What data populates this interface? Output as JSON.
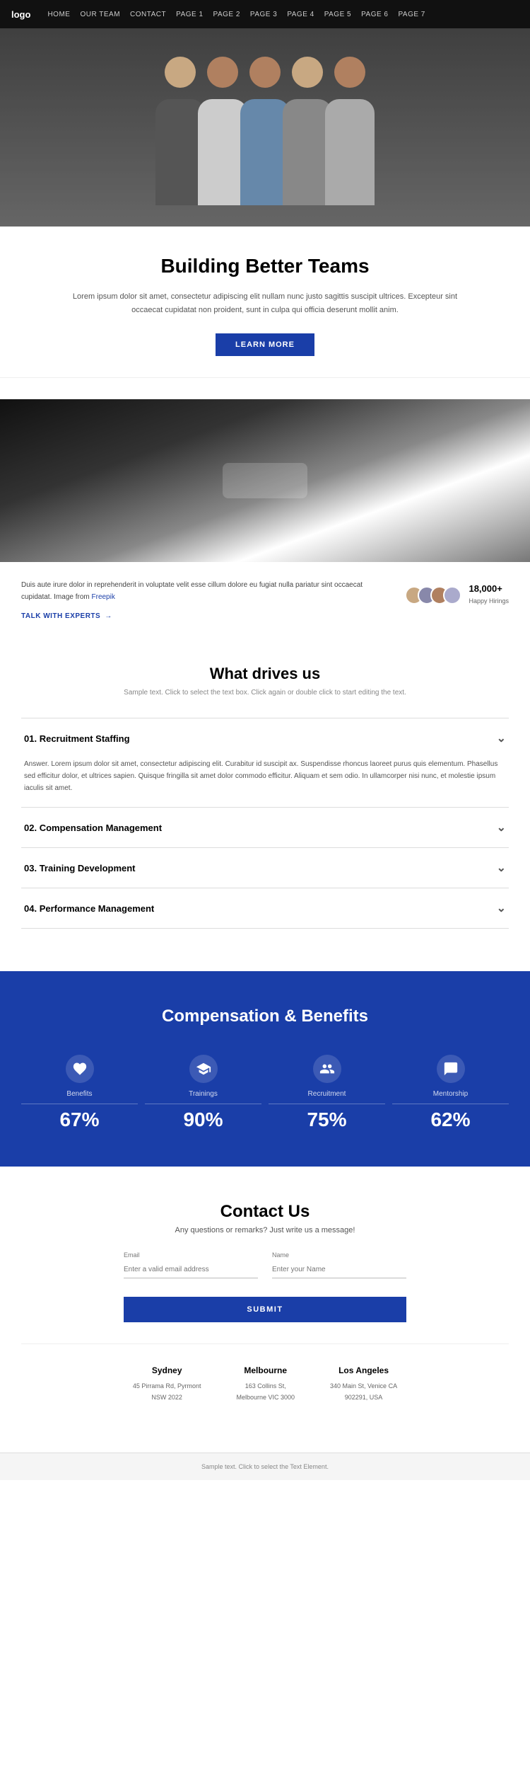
{
  "nav": {
    "logo": "logo",
    "items": [
      {
        "label": "HOME",
        "href": "#"
      },
      {
        "label": "OUR TEAM",
        "href": "#"
      },
      {
        "label": "CONTACT",
        "href": "#"
      },
      {
        "label": "PAGE 1",
        "href": "#"
      },
      {
        "label": "PAGE 2",
        "href": "#"
      },
      {
        "label": "PAGE 3",
        "href": "#"
      },
      {
        "label": "PAGE 4",
        "href": "#"
      },
      {
        "label": "PAGE 5",
        "href": "#"
      },
      {
        "label": "PAGE 6",
        "href": "#"
      },
      {
        "label": "PAGE 7",
        "href": "#"
      }
    ]
  },
  "intro": {
    "title": "Building Better Teams",
    "body": "Lorem ipsum dolor sit amet, consectetur adipiscing elit nullam nunc justo sagittis suscipit ultrices. Excepteur sint occaecat cupidatat non proident, sunt in culpa qui officia deserunt mollit anim.",
    "btn_label": "LEARN MORE"
  },
  "info": {
    "body": "Duis aute irure dolor in reprehenderit in voluptate velit esse cillum dolore eu fugiat nulla pariatur sint occaecat cupidatat. Image from",
    "freepik_link": "Freepik",
    "talk_label": "TALK WITH EXPERTS",
    "stat_number": "18,000+",
    "stat_label": "Happy Hirings"
  },
  "drives": {
    "title": "What drives us",
    "subtitle": "Sample text. Click to select the text box. Click again or double click to start editing the text.",
    "items": [
      {
        "number": "01.",
        "label": "Recruitment Staffing",
        "open": true,
        "content": "Answer. Lorem ipsum dolor sit amet, consectetur adipiscing elit. Curabitur id suscipit ax. Suspendisse rhoncus laoreet purus quis elementum. Phasellus sed efficitur dolor, et ultrices sapien. Quisque fringilla sit amet dolor commodo efficitur. Aliquam et sem odio. In ullamcorper nisi nunc, et molestie ipsum iaculis sit amet."
      },
      {
        "number": "02.",
        "label": "Compensation Management",
        "open": false,
        "content": ""
      },
      {
        "number": "03.",
        "label": "Training Development",
        "open": false,
        "content": ""
      },
      {
        "number": "04.",
        "label": "Performance Management",
        "open": false,
        "content": ""
      }
    ]
  },
  "comp_banner": {
    "title": "Compensation & Benefits",
    "stats": [
      {
        "icon": "benefits-icon",
        "label": "Benefits",
        "pct": "67%"
      },
      {
        "icon": "trainings-icon",
        "label": "Trainings",
        "pct": "90%"
      },
      {
        "icon": "recruitment-icon",
        "label": "Recruitment",
        "pct": "75%"
      },
      {
        "icon": "mentorship-icon",
        "label": "Mentorship",
        "pct": "62%"
      }
    ]
  },
  "contact": {
    "title": "Contact Us",
    "subtitle": "Any questions or remarks? Just write us a message!",
    "email_label": "Email",
    "email_placeholder": "Enter a valid email address",
    "name_label": "Name",
    "name_placeholder": "Enter your Name",
    "submit_label": "SUBMIT",
    "offices": [
      {
        "city": "Sydney",
        "address": "45 Pirrama Rd, Pyrmont",
        "postcode": "NSW 2022"
      },
      {
        "city": "Melbourne",
        "address": "163 Collins St,",
        "postcode": "Melbourne VIC 3000"
      },
      {
        "city": "Los Angeles",
        "address": "340 Main St, Venice CA",
        "postcode": "902291, USA"
      }
    ]
  },
  "footer": {
    "note": "Sample text. Click to select the Text Element."
  }
}
